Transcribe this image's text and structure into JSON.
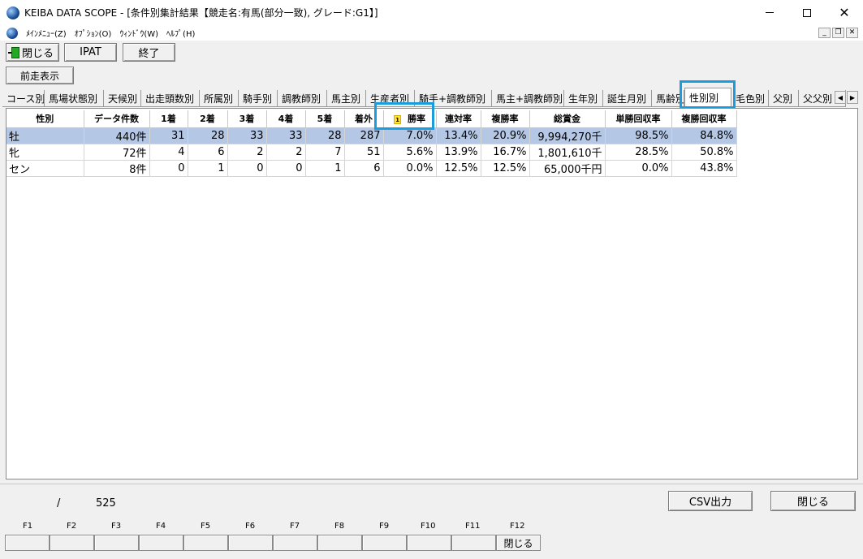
{
  "window": {
    "title": "KEIBA DATA SCOPE - [条件別集計結果【競走名:有馬(部分一致), グレード:G1】]"
  },
  "menu": {
    "items": [
      "ﾒｲﾝﾒﾆｭｰ(Z)",
      "ｵﾌﾟｼｮﾝ(O)",
      "ｳｨﾝﾄﾞｳ(W)",
      "ﾍﾙﾌﾟ(H)"
    ]
  },
  "toolbar": {
    "close_label": "閉じる",
    "ipat_label": "IPAT",
    "exit_label": "終了",
    "prev_label": "前走表示"
  },
  "tabs": [
    "コース別",
    "馬場状態別",
    "天候別",
    "出走頭数別",
    "所属別",
    "騎手別",
    "調教師別",
    "馬主別",
    "生産者別",
    "騎手+調教師別",
    "馬主+調教師別",
    "生年別",
    "誕生月別",
    "馬齢別",
    "性別別",
    "毛色別",
    "父別",
    "父父別"
  ],
  "active_tab": "性別別",
  "table": {
    "headers": [
      "性別",
      "データ件数",
      "1着",
      "2着",
      "3着",
      "4着",
      "5着",
      "着外",
      "勝率",
      "連対率",
      "複勝率",
      "総賞金",
      "単勝回収率",
      "複勝回収率"
    ],
    "sort_badge": "1",
    "rows": [
      [
        "牡",
        "440件",
        "31",
        "28",
        "33",
        "33",
        "28",
        "287",
        "7.0%",
        "13.4%",
        "20.9%",
        "9,994,270千",
        "98.5%",
        "84.8%"
      ],
      [
        "牝",
        "72件",
        "4",
        "6",
        "2",
        "2",
        "7",
        "51",
        "5.6%",
        "13.9%",
        "16.7%",
        "1,801,610千",
        "28.5%",
        "50.8%"
      ],
      [
        "セン",
        "8件",
        "0",
        "1",
        "0",
        "0",
        "1",
        "6",
        "0.0%",
        "12.5%",
        "12.5%",
        "65,000千円",
        "0.0%",
        "43.8%"
      ]
    ]
  },
  "status": {
    "separator": "/",
    "total": "525",
    "csv_label": "CSV出力",
    "close_label": "閉じる"
  },
  "fkeys": {
    "labels": [
      "F1",
      "F2",
      "F3",
      "F4",
      "F5",
      "F6",
      "F7",
      "F8",
      "F9",
      "F10",
      "F11",
      "F12"
    ],
    "buttons": [
      "",
      "",
      "",
      "",
      "",
      "",
      "",
      "",
      "",
      "",
      "",
      "閉じる"
    ]
  },
  "colors": {
    "highlight": "#1a9ddd",
    "selected_row": "#b4c8e6"
  }
}
